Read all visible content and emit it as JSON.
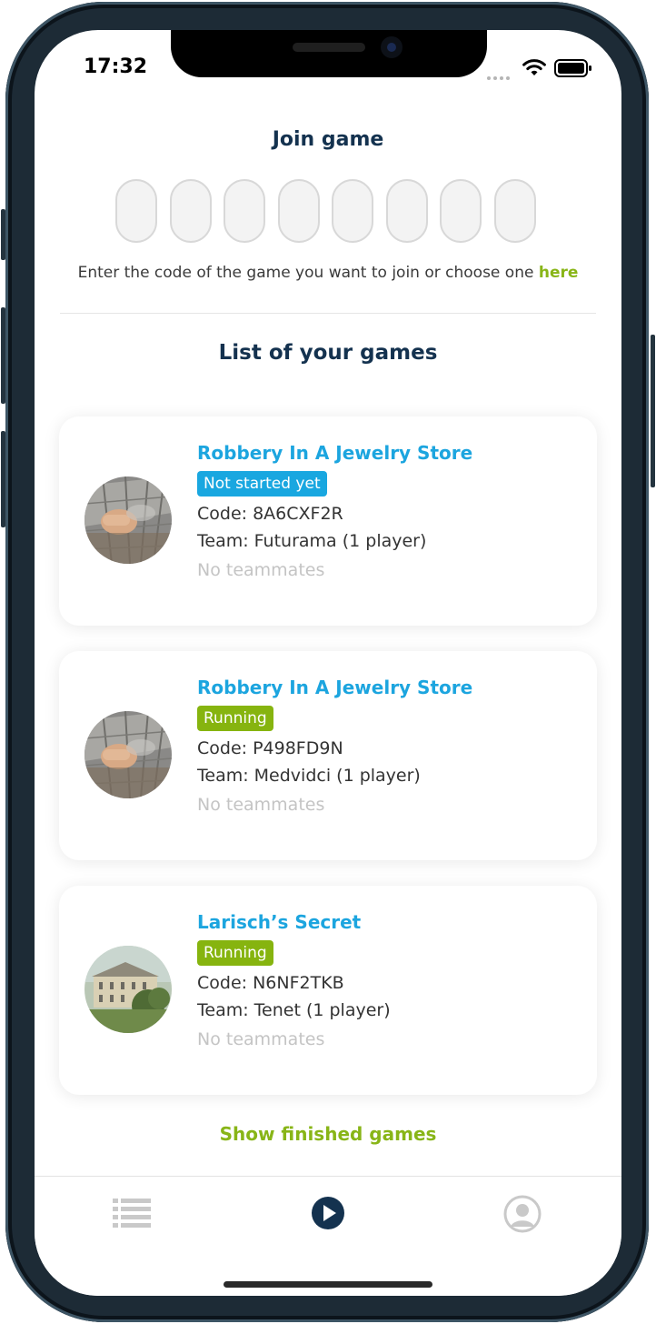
{
  "status_bar": {
    "time": "17:32"
  },
  "join": {
    "title": "Join game",
    "code_slots": [
      "",
      "",
      "",
      "",
      "",
      "",
      "",
      ""
    ],
    "hint_text": "Enter the code of the game you want to join or choose one ",
    "hint_link": "here"
  },
  "list_title": "List of your games",
  "games": [
    {
      "title": "Robbery In A Jewelry Store",
      "status": "Not started yet",
      "status_color": "#19a7e0",
      "code": "Code: 8A6CXF2R",
      "team": "Team: Futurama (1 player)",
      "teammates": "No teammates"
    },
    {
      "title": "Robbery In A Jewelry Store",
      "status": "Running",
      "status_color": "#86b40f",
      "code": "Code: P498FD9N",
      "team": "Team: Medvidci (1 player)",
      "teammates": "No teammates"
    },
    {
      "title": "Larisch’s Secret",
      "status": "Running",
      "status_color": "#86b40f",
      "code": "Code: N6NF2TKB",
      "team": "Team: Tenet (1 player)",
      "teammates": "No teammates"
    }
  ],
  "show_finished": "Show finished games",
  "tabbar": {
    "tabs": [
      {
        "icon": "list-icon",
        "active": false
      },
      {
        "icon": "play-icon",
        "active": true
      },
      {
        "icon": "profile-icon",
        "active": false
      }
    ]
  },
  "colors": {
    "navy": "#14324f",
    "accent_blue": "#1ca5df",
    "accent_green": "#88b517"
  }
}
